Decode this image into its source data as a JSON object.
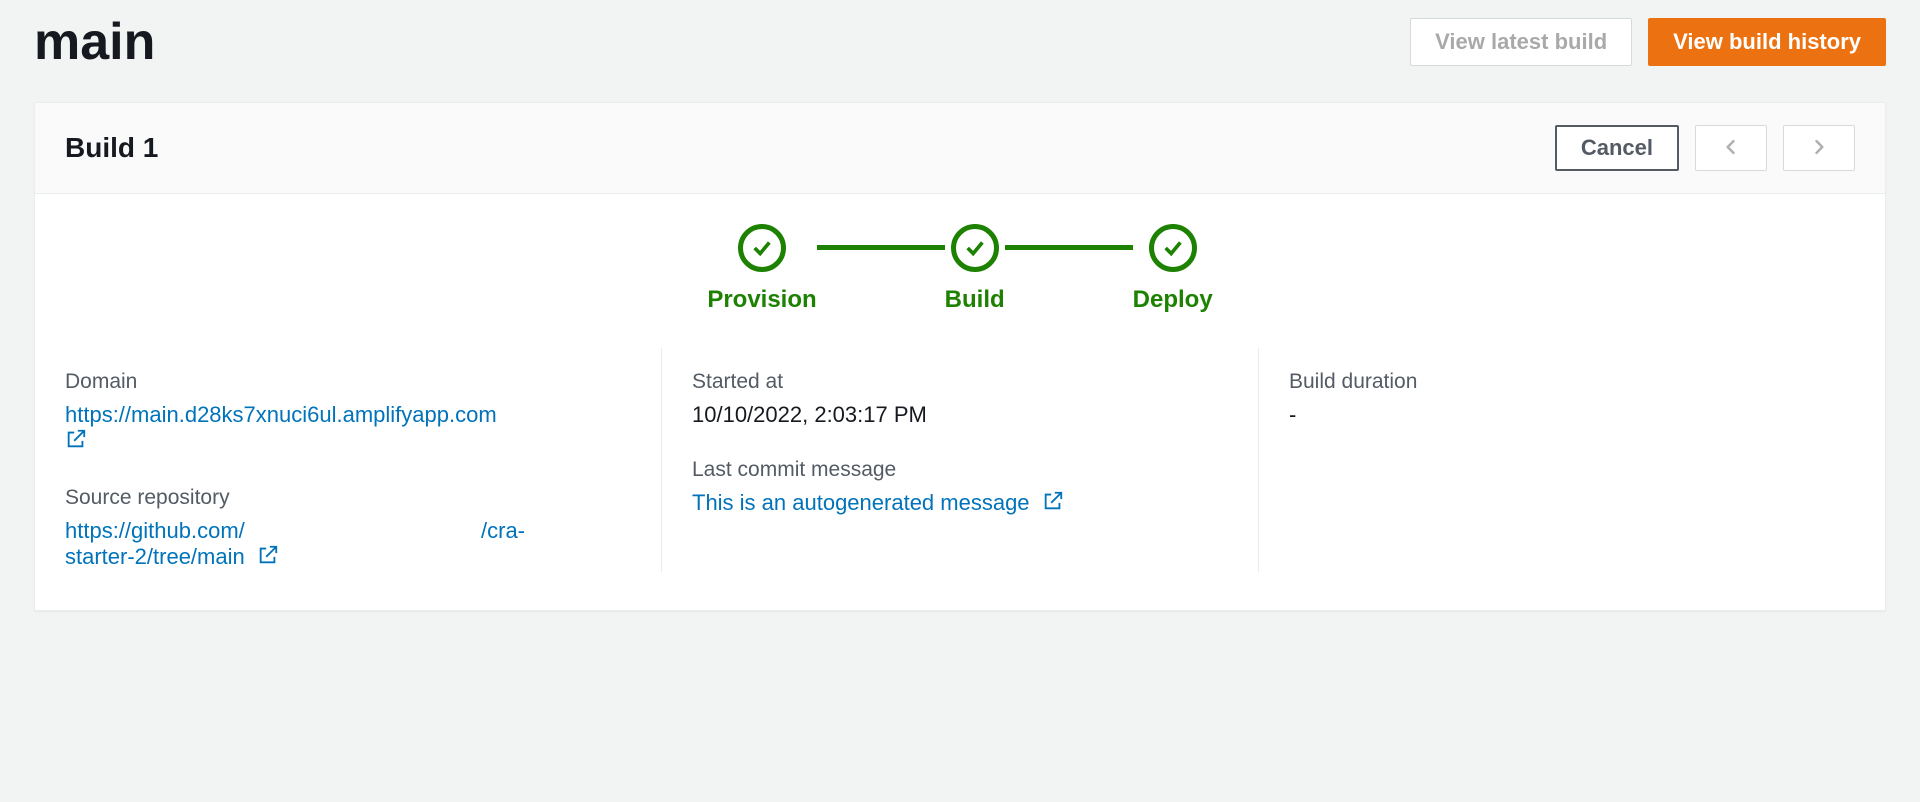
{
  "page": {
    "title": "main",
    "view_latest_build": "View latest build",
    "view_build_history": "View build history"
  },
  "build": {
    "title": "Build 1",
    "cancel": "Cancel"
  },
  "steps": {
    "provision": "Provision",
    "build": "Build",
    "deploy": "Deploy"
  },
  "details": {
    "domain_label": "Domain",
    "domain_url": "https://main.d28ks7xnuci6ul.amplifyapp.com",
    "started_at_label": "Started at",
    "started_at_value": "10/10/2022, 2:03:17 PM",
    "build_duration_label": "Build duration",
    "build_duration_value": "-",
    "source_repo_label": "Source repository",
    "source_repo_line1": "https://github.com/",
    "source_repo_line1_suffix": "/cra-",
    "source_repo_line2": "starter-2/tree/main",
    "commit_label": "Last commit message",
    "commit_value": "This is an autogenerated message"
  }
}
